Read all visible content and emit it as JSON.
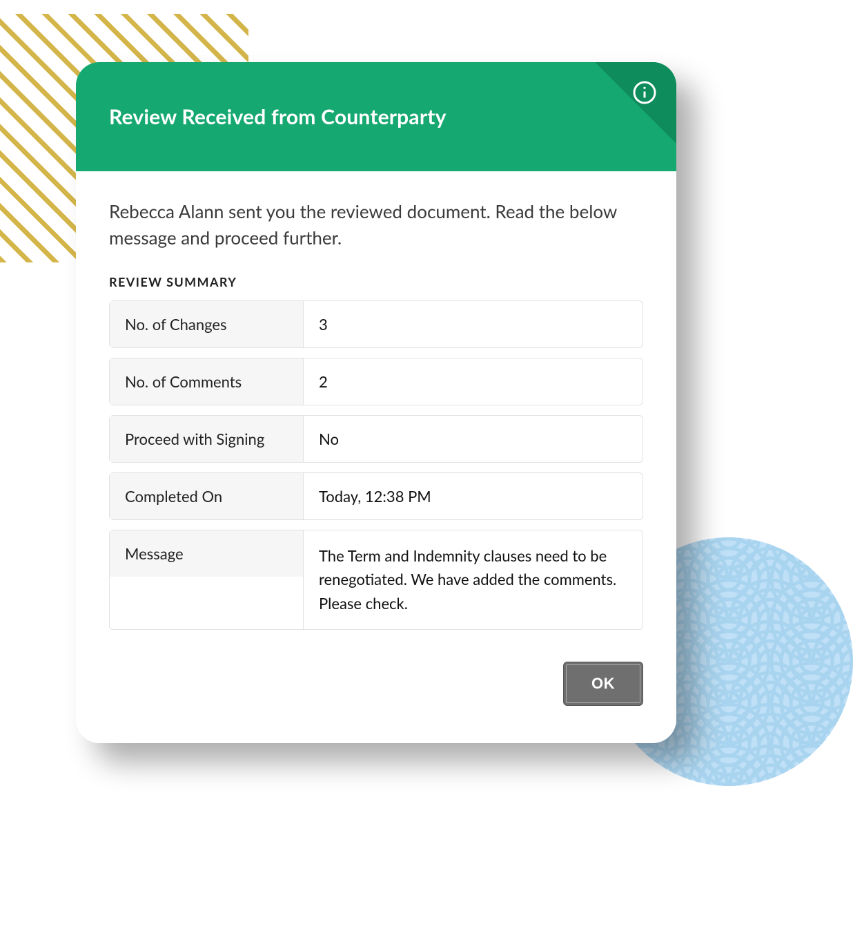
{
  "header": {
    "title": "Review Received from Counterparty"
  },
  "intro": "Rebecca Alann sent you the reviewed document. Read the below message and proceed further.",
  "sectionLabel": "REVIEW SUMMARY",
  "summary": {
    "rows": [
      {
        "label": "No. of Changes",
        "value": "3"
      },
      {
        "label": "No. of Comments",
        "value": "2"
      },
      {
        "label": "Proceed with Signing",
        "value": "No"
      },
      {
        "label": "Completed On",
        "value": "Today, 12:38 PM"
      },
      {
        "label": "Message",
        "value": "The Term and Indemnity clauses need to be renegotiated. We have added the comments. Please check."
      }
    ]
  },
  "actions": {
    "ok": "OK"
  },
  "icons": {
    "info": "info-icon"
  },
  "colors": {
    "accent": "#16a871",
    "buttonGray": "#6f6f6f",
    "gold": "#d4b54a",
    "sky": "#bfe0f6"
  }
}
